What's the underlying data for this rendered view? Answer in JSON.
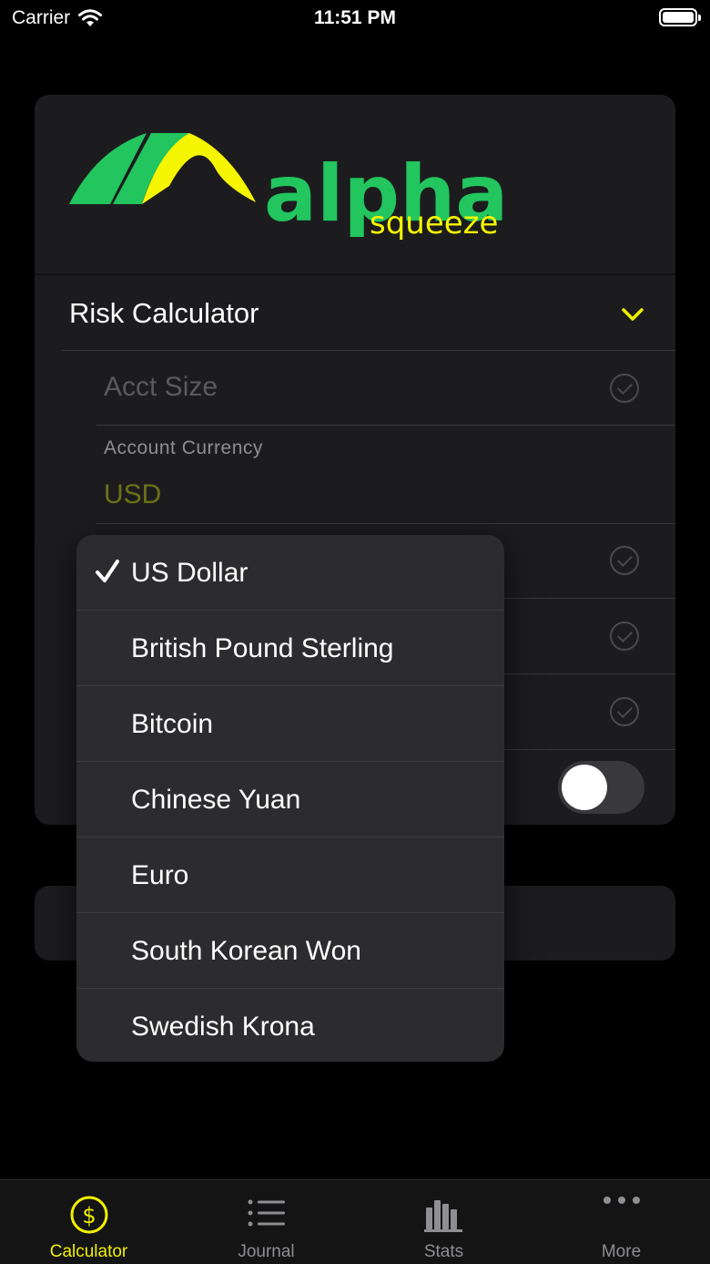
{
  "status_bar": {
    "carrier": "Carrier",
    "time": "11:51 PM"
  },
  "brand": {
    "word": "alpha",
    "sub": "squeeze",
    "green": "#22c55e",
    "yellow": "#f5f500"
  },
  "calculator": {
    "title": "Risk Calculator",
    "acct_size_placeholder": "Acct Size",
    "account_currency_label": "Account Currency",
    "account_currency_value": "USD"
  },
  "currency_menu": {
    "selected": "US Dollar",
    "items": [
      "US Dollar",
      "British Pound Sterling",
      "Bitcoin",
      "Chinese Yuan",
      "Euro",
      "South Korean Won",
      "Swedish Krona"
    ]
  },
  "tabs": [
    {
      "label": "Calculator",
      "icon": "dollar-circle-icon",
      "active": true
    },
    {
      "label": "Journal",
      "icon": "list-icon",
      "active": false
    },
    {
      "label": "Stats",
      "icon": "bar-chart-icon",
      "active": false
    },
    {
      "label": "More",
      "icon": "ellipsis-icon",
      "active": false
    }
  ],
  "colors": {
    "accent": "#f0f000",
    "background": "#000000",
    "card": "#1c1c1e",
    "menu": "#2c2c2e"
  }
}
